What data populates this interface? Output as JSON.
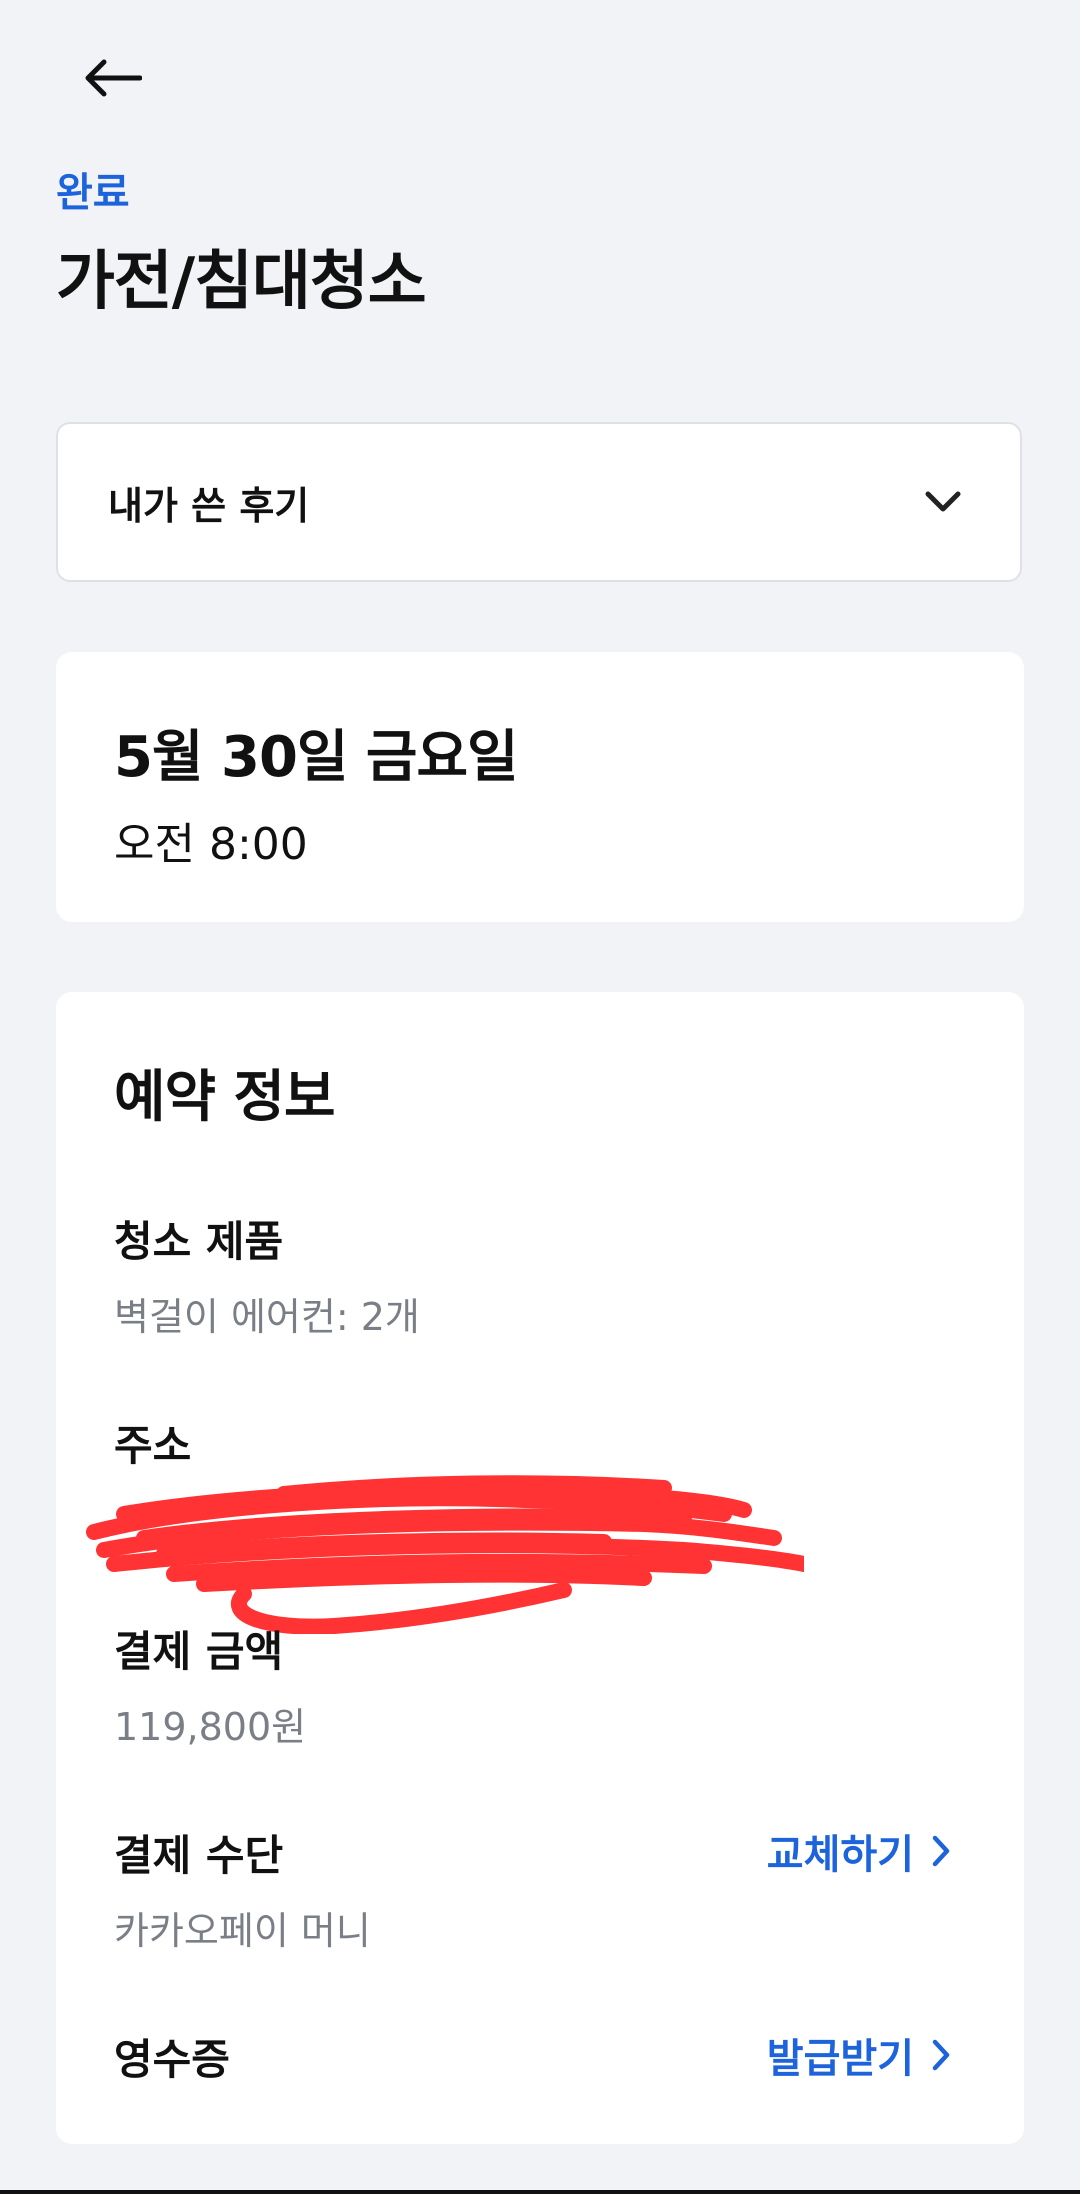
{
  "header": {
    "back_icon": "arrow-left-icon",
    "status": "완료",
    "title": "가전/침대청소"
  },
  "review": {
    "label": "내가 쓴 후기",
    "icon": "chevron-down-icon"
  },
  "schedule": {
    "date": "5월 30일 금요일",
    "time": "오전 8:00"
  },
  "reservation": {
    "title": "예약 정보",
    "product": {
      "label": "청소 제품",
      "value": "벽걸이 에어컨: 2개"
    },
    "address": {
      "label": "주소"
    },
    "payment_amount": {
      "label": "결제 금액",
      "value": "119,800원"
    },
    "payment_method": {
      "label": "결제 수단",
      "value": "카카오페이 머니",
      "action": "교체하기"
    },
    "receipt": {
      "label": "영수증",
      "action": "발급받기"
    }
  },
  "colors": {
    "accent": "#1d63db",
    "background": "#f2f3f6",
    "redaction": "#ff3333"
  }
}
